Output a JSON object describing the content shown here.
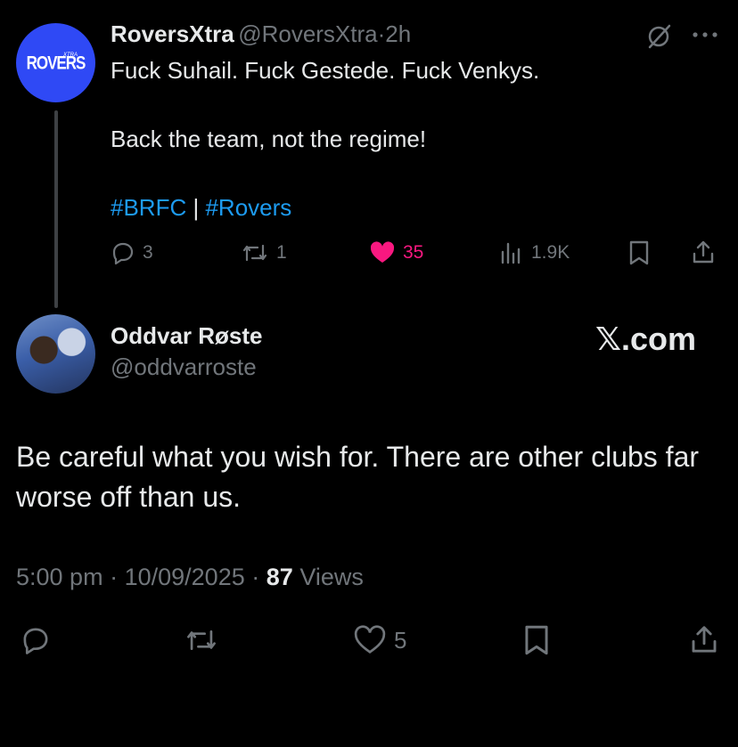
{
  "quoted_post": {
    "avatar_text": "ROVERS",
    "avatar_subtext": "XTRA",
    "display_name": "RoversXtra",
    "handle": "@RoversXtra",
    "separator": "·",
    "time_ago": "2h",
    "lines": [
      "Fuck Suhail. Fuck Gestede. Fuck Venkys.",
      "Back the team, not the regime!"
    ],
    "hashtag1": "#BRFC",
    "hashtag_sep": " | ",
    "hashtag2": "#Rovers",
    "actions": {
      "replies": "3",
      "reposts": "1",
      "likes": "35",
      "views": "1.9K"
    },
    "icons": [
      "grok-icon",
      "more-icon",
      "reply-icon",
      "repost-icon",
      "heart-filled-icon",
      "views-icon",
      "bookmark-icon",
      "share-icon"
    ],
    "like_color": "#f91880"
  },
  "reply": {
    "display_name": "Oddvar Røste",
    "handle": "@oddvarroste",
    "brand": "𝕏.com",
    "text": "Be careful what you wish for. There are other clubs far worse off than us.",
    "time": "5:00 pm",
    "date": "10/09/2025",
    "dot": "·",
    "views_count": "87",
    "views_label": "Views",
    "likes": "5"
  },
  "colors": {
    "background": "#000000",
    "text": "#e7e9ea",
    "muted": "#71767b",
    "link": "#1d9bf0",
    "avatar": "#2f49f5"
  }
}
